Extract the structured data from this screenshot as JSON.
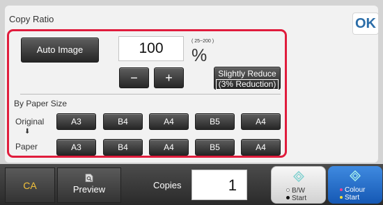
{
  "header": {
    "title": "Copy Ratio",
    "ok_label": "OK"
  },
  "ratio": {
    "auto_image_label": "Auto Image",
    "value": "100",
    "range": "( 25~200 )",
    "unit": "%",
    "minus_label": "−",
    "plus_label": "+",
    "slightly_reduce_line1": "Slightly Reduce",
    "slightly_reduce_line2": "(3% Reduction)"
  },
  "paper_size": {
    "heading": "By Paper Size",
    "original_label": "Original",
    "arrow": "⬇",
    "paper_label": "Paper",
    "original_sizes": [
      "A3",
      "B4",
      "A4",
      "B5",
      "A4"
    ],
    "paper_sizes": [
      "A3",
      "B4",
      "A4",
      "B5",
      "A4"
    ]
  },
  "bottom_bar": {
    "ca_label": "CA",
    "preview_label": "Preview",
    "copies_label": "Copies",
    "copies_value": "1",
    "bw_start_line1": "B/W",
    "bw_start_line2": "Start",
    "colour_start_line1": "Colour",
    "colour_start_line2": "Start"
  },
  "colors": {
    "frame_accent": "#e01c3c",
    "ok_text": "#2b6da8",
    "ca_text": "#f2c13b",
    "colour_start_bg": "#1f6dd0"
  },
  "icons": [
    "preview-icon",
    "bw-start-icon",
    "colour-start-icon",
    "down-arrow-icon"
  ]
}
